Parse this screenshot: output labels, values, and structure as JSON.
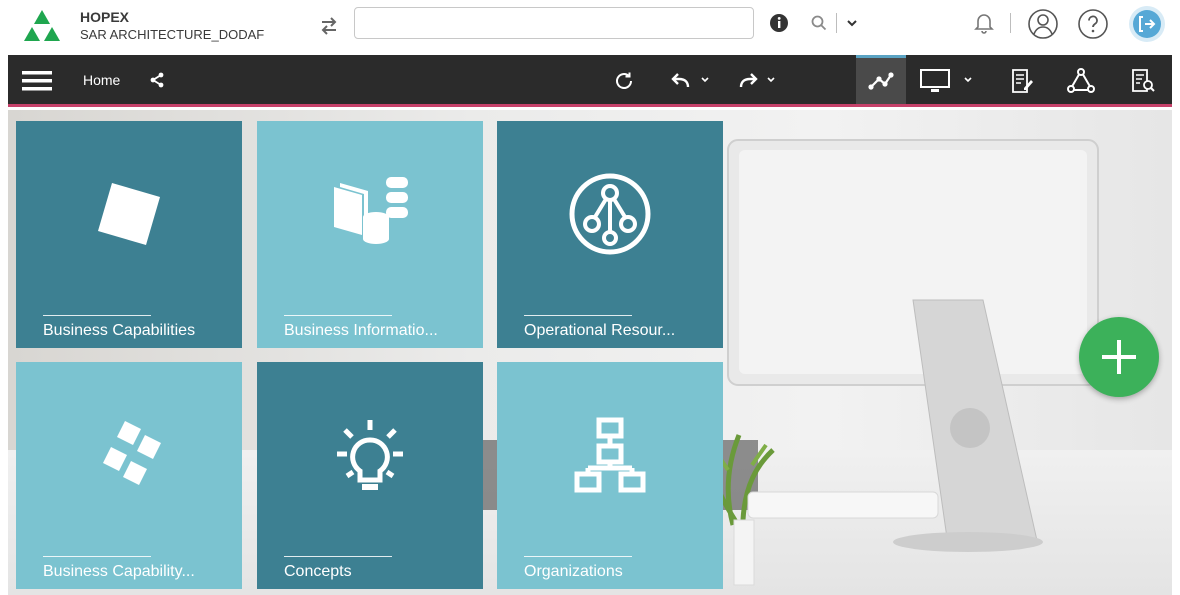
{
  "app": {
    "name": "HOPEX",
    "workspace": "SAR ARCHITECTURE_DODAF"
  },
  "header": {
    "search": {
      "value": "",
      "placeholder": ""
    },
    "icons": [
      "swap-icon",
      "info-icon",
      "search-icon",
      "chevron-down-icon",
      "bell-icon",
      "user-icon",
      "help-icon",
      "logout-icon"
    ]
  },
  "nav": {
    "home_label": "Home",
    "icons": [
      "menu-icon",
      "share-icon",
      "refresh-icon",
      "undo-icon",
      "redo-icon",
      "diagram-icon",
      "desktop-icon",
      "report-icon",
      "object-icon",
      "report-search-icon"
    ]
  },
  "tiles": [
    {
      "label": "Business Capabilities",
      "icon": "cube-icon",
      "tone": "dark"
    },
    {
      "label": "Business Informatio...",
      "icon": "data-icon",
      "tone": "light"
    },
    {
      "label": "Operational Resour...",
      "icon": "network-icon",
      "tone": "dark"
    },
    {
      "label": "Business Capability...",
      "icon": "cubes-icon",
      "tone": "light"
    },
    {
      "label": "Concepts",
      "icon": "lightbulb-icon",
      "tone": "dark"
    },
    {
      "label": "Organizations",
      "icon": "org-chart-icon",
      "tone": "light"
    }
  ],
  "colors": {
    "tile_dark": "#3d8092",
    "tile_light": "#7bc3d0",
    "nav_bg": "#2b2b2b",
    "nav_accent": "#c6416a",
    "fab": "#3cb15a",
    "logout": "#56a8d6"
  }
}
